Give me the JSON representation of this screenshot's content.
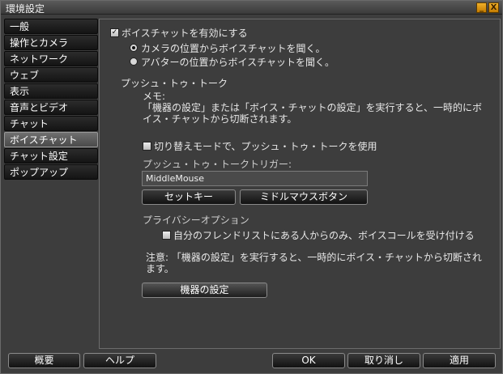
{
  "window": {
    "title": "環境設定",
    "minimize_glyph": "_",
    "close_glyph": "X"
  },
  "sidebar": {
    "items": [
      {
        "label": "一般"
      },
      {
        "label": "操作とカメラ"
      },
      {
        "label": "ネットワーク"
      },
      {
        "label": "ウェブ"
      },
      {
        "label": "表示"
      },
      {
        "label": "音声とビデオ"
      },
      {
        "label": "チャット"
      },
      {
        "label": "ボイスチャット",
        "active": true
      },
      {
        "label": "チャット設定"
      },
      {
        "label": "ポップアップ"
      }
    ]
  },
  "voice": {
    "enable_label": "ボイスチャットを有効にする",
    "enable_checked": true,
    "radio_camera_label": "カメラの位置からボイスチャットを聞く。",
    "radio_camera_selected": true,
    "radio_avatar_label": "アバターの位置からボイスチャットを聞く。",
    "radio_avatar_selected": false
  },
  "ptt": {
    "section_title": "プッシュ・トゥ・トーク",
    "memo_label": "メモ:",
    "memo_line1": "「機器の設定」または「ボイス・チャットの設定」を実行すると、一時的にボ",
    "memo_line2": "イス・チャットから切断されます。",
    "toggle_label": "切り替えモードで、プッシュ・トゥ・トークを使用",
    "toggle_checked": false,
    "trigger_label": "プッシュ・トゥ・トークトリガー:",
    "trigger_value": "MiddleMouse",
    "set_key_label": "セットキー",
    "middle_mouse_label": "ミドルマウスボタン"
  },
  "privacy": {
    "section_title": "プライバシーオプション",
    "friends_only_label": "自分のフレンドリストにある人からのみ、ボイスコールを受け付ける",
    "friends_only_checked": false,
    "note_line1": "注意: 「機器の設定」を実行すると、一時的にボイス・チャットから切断され",
    "note_line2": "ます。",
    "device_settings_label": "機器の設定"
  },
  "footer": {
    "about_label": "概要",
    "help_label": "ヘルプ",
    "ok_label": "OK",
    "cancel_label": "取り消し",
    "apply_label": "適用"
  }
}
